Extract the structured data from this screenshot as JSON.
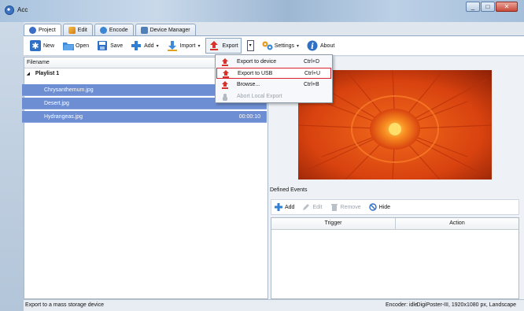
{
  "window": {
    "title": "Acc",
    "minimize": "_",
    "maximize": "□",
    "close": "✕"
  },
  "tabs": [
    {
      "label": "Project",
      "icon": "project-icon",
      "color": "#3a6ec8"
    },
    {
      "label": "Edit",
      "icon": "pencil-icon",
      "color": "#e08a1c"
    },
    {
      "label": "Encode",
      "icon": "encode-icon",
      "color": "#3b87d6"
    },
    {
      "label": "Device Manager",
      "icon": "monitor-icon",
      "color": "#4f7fb8"
    }
  ],
  "toolbar": {
    "new": "New",
    "open": "Open",
    "save": "Save",
    "add": "Add",
    "import": "Import",
    "export": "Export",
    "settings": "Settings",
    "about": "About",
    "caret": "▾",
    "split": "▾"
  },
  "playlist": {
    "column_filename": "Filename",
    "expand": "◢",
    "name": "Playlist 1",
    "items": [
      {
        "name": "Chrysanthemum.jpg",
        "duration": ""
      },
      {
        "name": "Desert.jpg",
        "duration": ""
      },
      {
        "name": "Hydrangeas.jpg",
        "duration": "00:00:10"
      }
    ]
  },
  "export_menu": [
    {
      "label": "Export to device",
      "shortcut": "Ctrl+D"
    },
    {
      "label": "Export to USB",
      "shortcut": "Ctrl+U"
    },
    {
      "label": "Browse...",
      "shortcut": "Ctrl+B"
    },
    {
      "label": "Abort Local Export",
      "shortcut": ""
    }
  ],
  "events": {
    "title": "Defined Events",
    "add": "Add",
    "edit": "Edit",
    "remove": "Remove",
    "hide": "Hide",
    "col_trigger": "Trigger",
    "col_action": "Action"
  },
  "status": {
    "message": "Export to a mass storage device",
    "encoder": "Encoder: idle",
    "device": "DigiPoster-III, 1920x1080 px, Landscape"
  },
  "colors": {
    "selection": "#6d8ed2",
    "menu_highlight": "#d8242b",
    "export_icon": "#d6332a"
  }
}
